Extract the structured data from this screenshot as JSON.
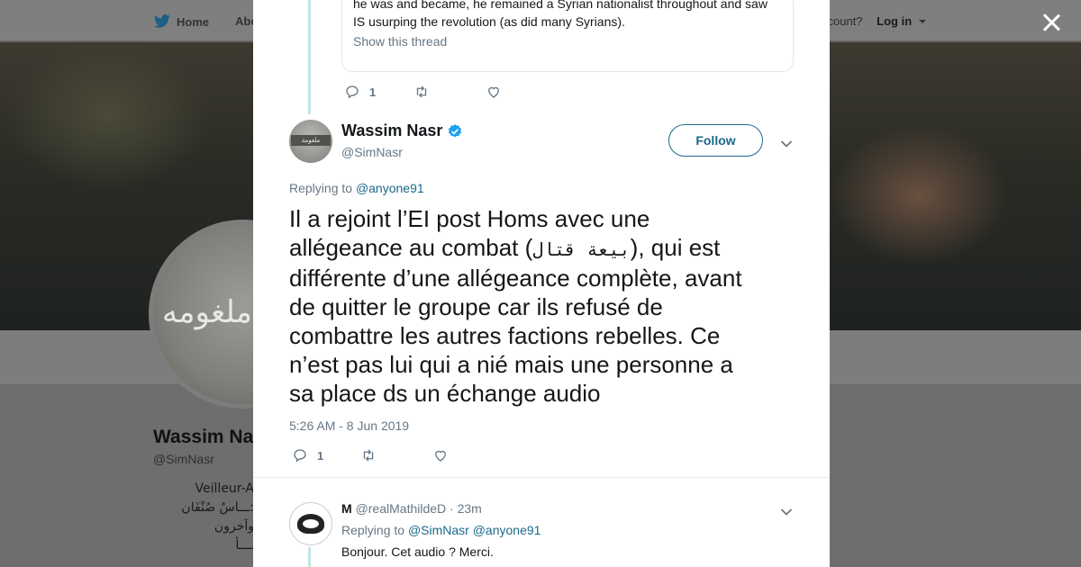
{
  "nav": {
    "home": "Home",
    "about": "Abo",
    "account_prompt": "ccount?",
    "login": "Log in"
  },
  "background_profile": {
    "name": "Wassim Na",
    "handle": "@SimNasr",
    "bio_lines": [
      "Veilleur-A",
      "ـــاسٌ صُنْفَان:",
      "وآخرون",
      "ــــأ"
    ],
    "avatar_text": "ي ملغومه"
  },
  "quote": {
    "lines": [
      "he was and became, he remained a Syrian nationalist throughout and saw",
      "IS usurping the revolution (as did many Syrians)."
    ],
    "show_thread": "Show this thread"
  },
  "prev_actions": {
    "reply_count": "1"
  },
  "tweet": {
    "author_name": "Wassim Nasr",
    "author_handle": "@SimNasr",
    "avatar_text": "ملغومة",
    "follow_label": "Follow",
    "replying_prefix": "Replying to",
    "replying_mention": "@anyone91",
    "text_lines": [
      "Il a rejoint l’EI post Homs avec une",
      "allégeance au combat (",
      "بيعة قتال",
      "), qui est",
      "différente d’une allégeance complète, avant",
      "de quitter le groupe car ils refusé de",
      "combattre les autres factions rebelles. Ce",
      "n’est pas lui qui a nié mais une personne a",
      "sa place ds un échange audio"
    ],
    "timestamp": "5:26 AM - 8 Jun 2019",
    "reply_count": "1"
  },
  "reply": {
    "name": "M",
    "handle": "@realMathildeD",
    "time": "· 23m",
    "replying_prefix": "Replying to",
    "mention1": "@SimNasr",
    "mention2": "@anyone91",
    "text": "Bonjour. Cet audio ? Merci."
  },
  "colors": {
    "link": "#1a6a8a",
    "muted": "#657786",
    "verified": "#1da1f2",
    "thread_line": "#c6e4ea"
  }
}
